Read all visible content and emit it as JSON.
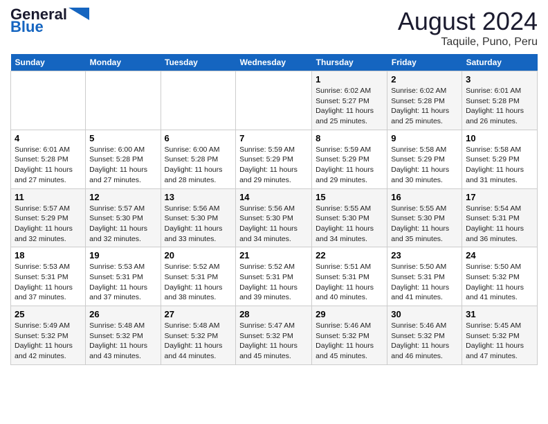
{
  "logo": {
    "line1": "General",
    "line2": "Blue"
  },
  "title": "August 2024",
  "subtitle": "Taquile, Puno, Peru",
  "days_of_week": [
    "Sunday",
    "Monday",
    "Tuesday",
    "Wednesday",
    "Thursday",
    "Friday",
    "Saturday"
  ],
  "weeks": [
    [
      {
        "num": "",
        "info": ""
      },
      {
        "num": "",
        "info": ""
      },
      {
        "num": "",
        "info": ""
      },
      {
        "num": "",
        "info": ""
      },
      {
        "num": "1",
        "info": "Sunrise: 6:02 AM\nSunset: 5:27 PM\nDaylight: 11 hours and 25 minutes."
      },
      {
        "num": "2",
        "info": "Sunrise: 6:02 AM\nSunset: 5:28 PM\nDaylight: 11 hours and 25 minutes."
      },
      {
        "num": "3",
        "info": "Sunrise: 6:01 AM\nSunset: 5:28 PM\nDaylight: 11 hours and 26 minutes."
      }
    ],
    [
      {
        "num": "4",
        "info": "Sunrise: 6:01 AM\nSunset: 5:28 PM\nDaylight: 11 hours and 27 minutes."
      },
      {
        "num": "5",
        "info": "Sunrise: 6:00 AM\nSunset: 5:28 PM\nDaylight: 11 hours and 27 minutes."
      },
      {
        "num": "6",
        "info": "Sunrise: 6:00 AM\nSunset: 5:28 PM\nDaylight: 11 hours and 28 minutes."
      },
      {
        "num": "7",
        "info": "Sunrise: 5:59 AM\nSunset: 5:29 PM\nDaylight: 11 hours and 29 minutes."
      },
      {
        "num": "8",
        "info": "Sunrise: 5:59 AM\nSunset: 5:29 PM\nDaylight: 11 hours and 29 minutes."
      },
      {
        "num": "9",
        "info": "Sunrise: 5:58 AM\nSunset: 5:29 PM\nDaylight: 11 hours and 30 minutes."
      },
      {
        "num": "10",
        "info": "Sunrise: 5:58 AM\nSunset: 5:29 PM\nDaylight: 11 hours and 31 minutes."
      }
    ],
    [
      {
        "num": "11",
        "info": "Sunrise: 5:57 AM\nSunset: 5:29 PM\nDaylight: 11 hours and 32 minutes."
      },
      {
        "num": "12",
        "info": "Sunrise: 5:57 AM\nSunset: 5:30 PM\nDaylight: 11 hours and 32 minutes."
      },
      {
        "num": "13",
        "info": "Sunrise: 5:56 AM\nSunset: 5:30 PM\nDaylight: 11 hours and 33 minutes."
      },
      {
        "num": "14",
        "info": "Sunrise: 5:56 AM\nSunset: 5:30 PM\nDaylight: 11 hours and 34 minutes."
      },
      {
        "num": "15",
        "info": "Sunrise: 5:55 AM\nSunset: 5:30 PM\nDaylight: 11 hours and 34 minutes."
      },
      {
        "num": "16",
        "info": "Sunrise: 5:55 AM\nSunset: 5:30 PM\nDaylight: 11 hours and 35 minutes."
      },
      {
        "num": "17",
        "info": "Sunrise: 5:54 AM\nSunset: 5:31 PM\nDaylight: 11 hours and 36 minutes."
      }
    ],
    [
      {
        "num": "18",
        "info": "Sunrise: 5:53 AM\nSunset: 5:31 PM\nDaylight: 11 hours and 37 minutes."
      },
      {
        "num": "19",
        "info": "Sunrise: 5:53 AM\nSunset: 5:31 PM\nDaylight: 11 hours and 37 minutes."
      },
      {
        "num": "20",
        "info": "Sunrise: 5:52 AM\nSunset: 5:31 PM\nDaylight: 11 hours and 38 minutes."
      },
      {
        "num": "21",
        "info": "Sunrise: 5:52 AM\nSunset: 5:31 PM\nDaylight: 11 hours and 39 minutes."
      },
      {
        "num": "22",
        "info": "Sunrise: 5:51 AM\nSunset: 5:31 PM\nDaylight: 11 hours and 40 minutes."
      },
      {
        "num": "23",
        "info": "Sunrise: 5:50 AM\nSunset: 5:31 PM\nDaylight: 11 hours and 41 minutes."
      },
      {
        "num": "24",
        "info": "Sunrise: 5:50 AM\nSunset: 5:32 PM\nDaylight: 11 hours and 41 minutes."
      }
    ],
    [
      {
        "num": "25",
        "info": "Sunrise: 5:49 AM\nSunset: 5:32 PM\nDaylight: 11 hours and 42 minutes."
      },
      {
        "num": "26",
        "info": "Sunrise: 5:48 AM\nSunset: 5:32 PM\nDaylight: 11 hours and 43 minutes."
      },
      {
        "num": "27",
        "info": "Sunrise: 5:48 AM\nSunset: 5:32 PM\nDaylight: 11 hours and 44 minutes."
      },
      {
        "num": "28",
        "info": "Sunrise: 5:47 AM\nSunset: 5:32 PM\nDaylight: 11 hours and 45 minutes."
      },
      {
        "num": "29",
        "info": "Sunrise: 5:46 AM\nSunset: 5:32 PM\nDaylight: 11 hours and 45 minutes."
      },
      {
        "num": "30",
        "info": "Sunrise: 5:46 AM\nSunset: 5:32 PM\nDaylight: 11 hours and 46 minutes."
      },
      {
        "num": "31",
        "info": "Sunrise: 5:45 AM\nSunset: 5:32 PM\nDaylight: 11 hours and 47 minutes."
      }
    ]
  ]
}
